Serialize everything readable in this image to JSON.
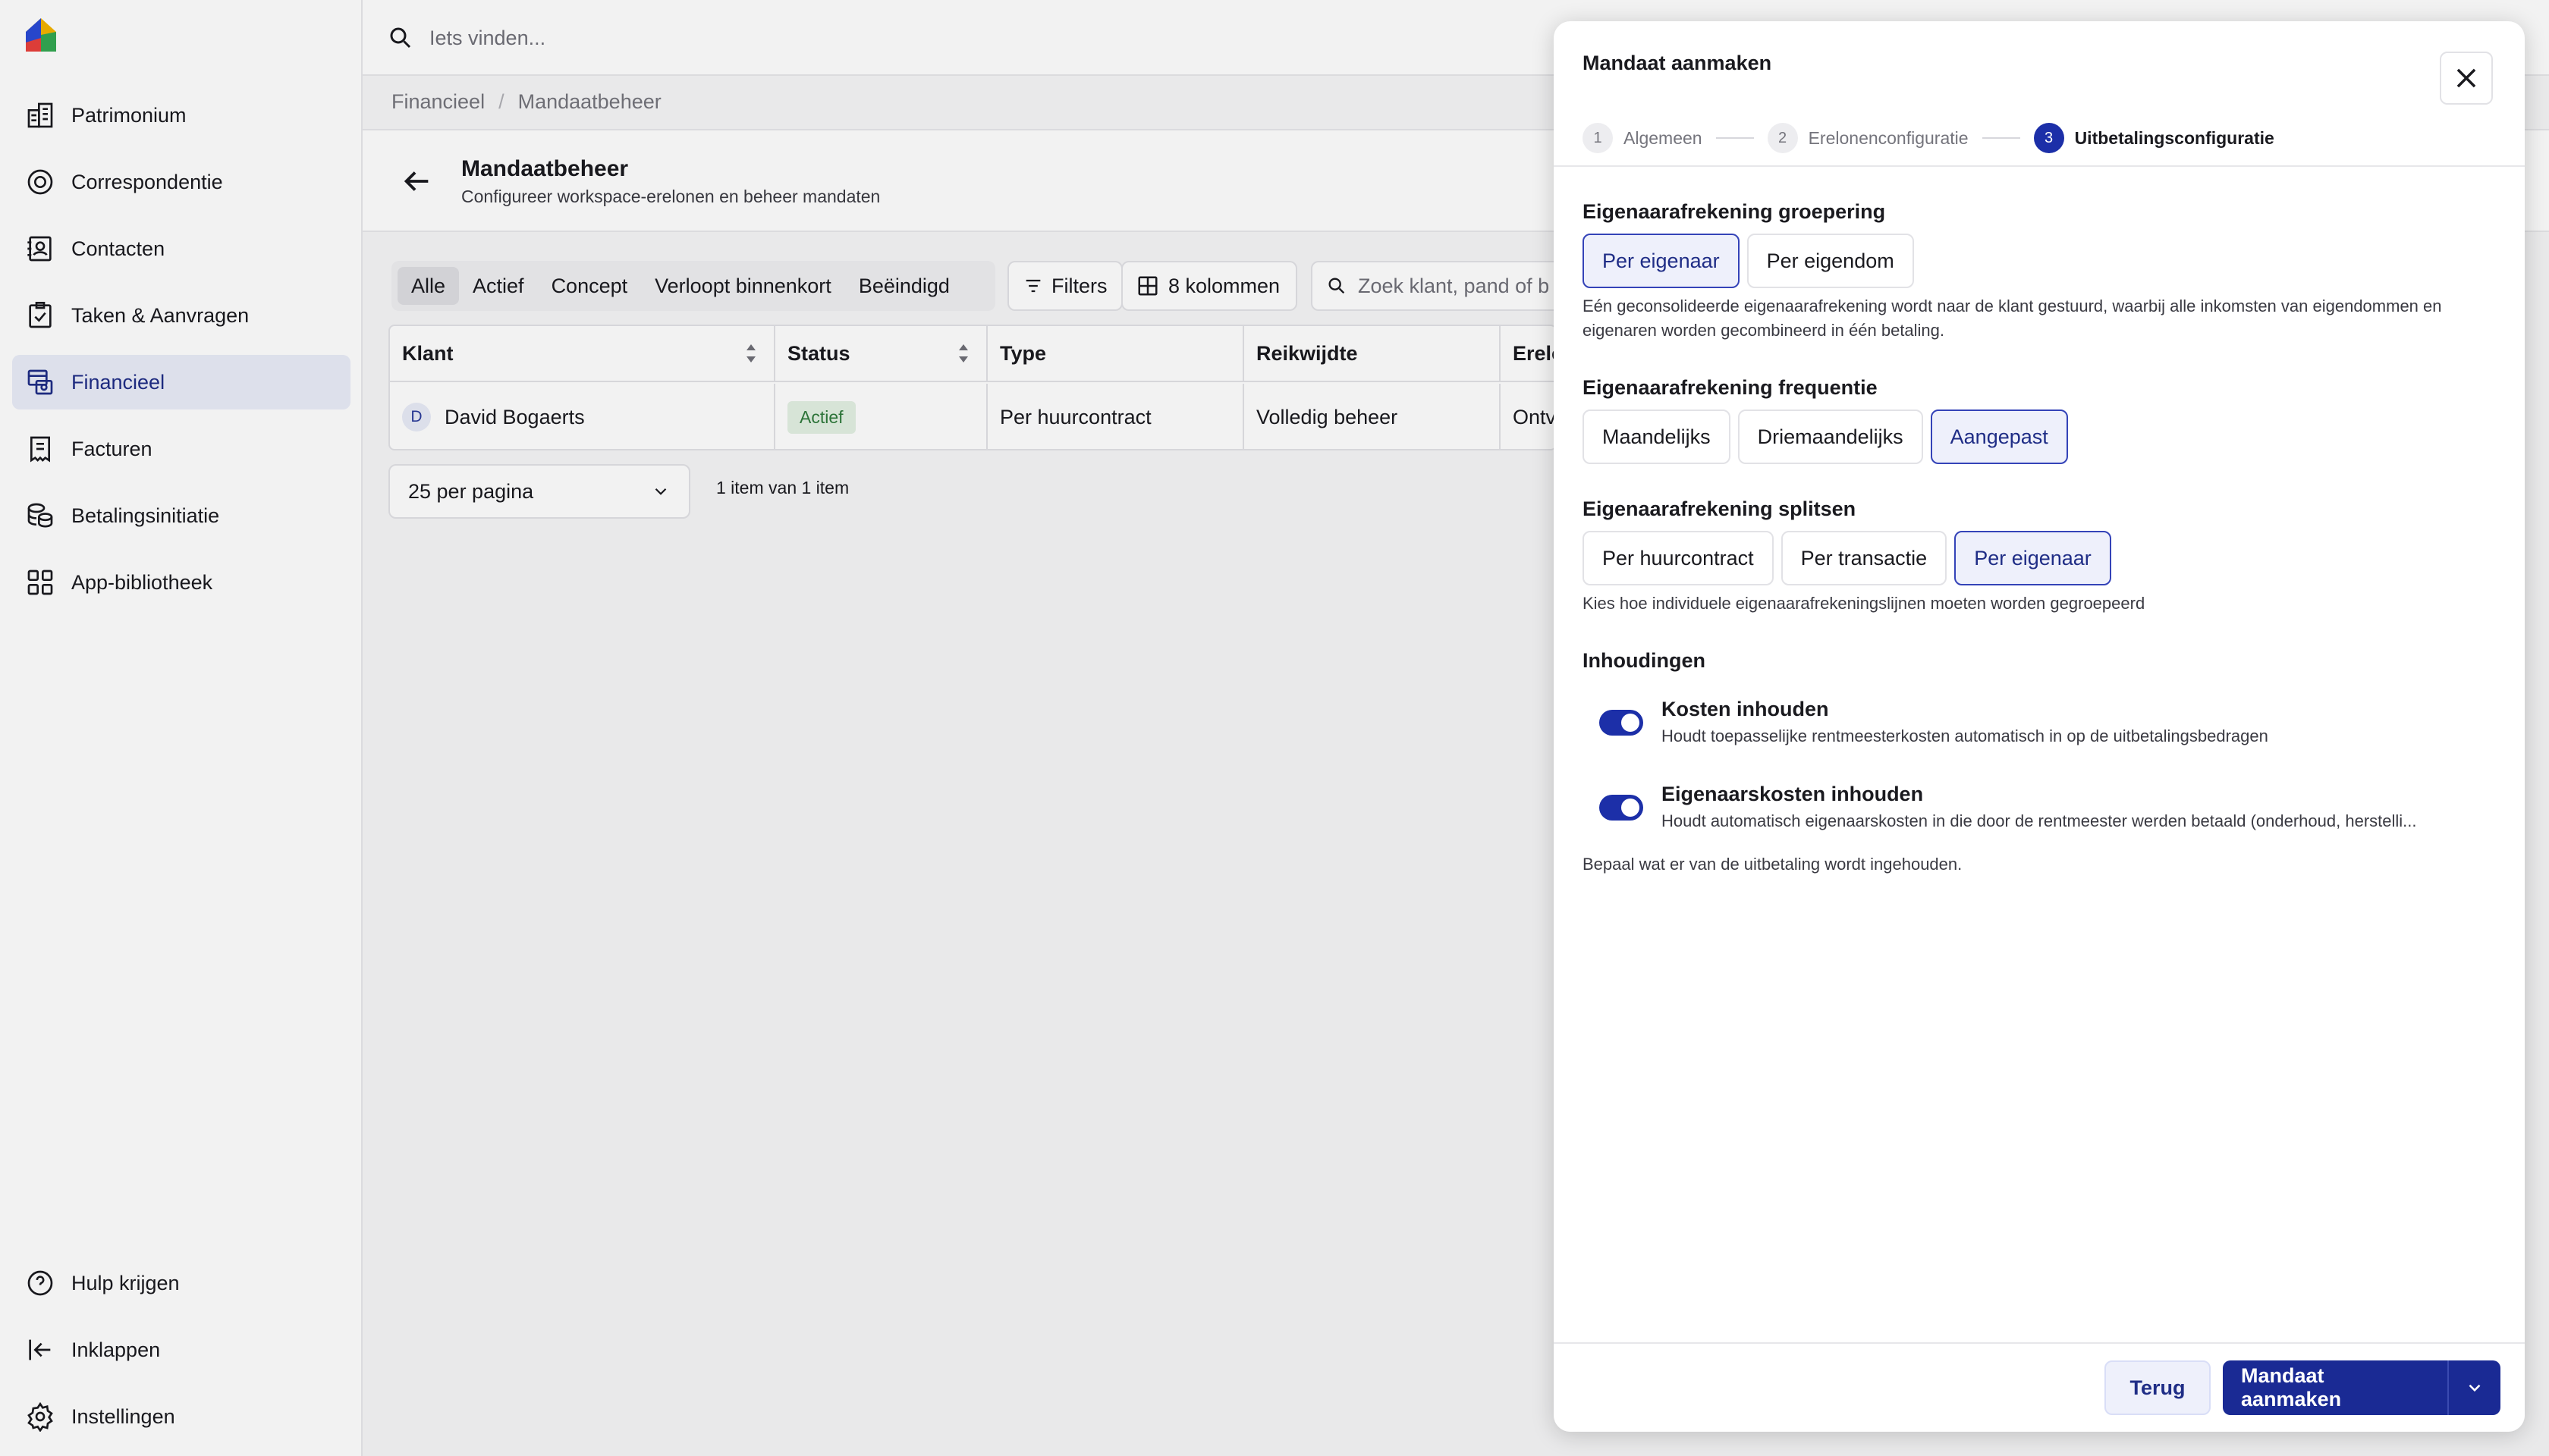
{
  "search": {
    "placeholder": "Iets vinden..."
  },
  "sidebar": {
    "items": [
      {
        "label": "Patrimonium",
        "icon": "building-icon"
      },
      {
        "label": "Correspondentie",
        "icon": "mail-circle-icon"
      },
      {
        "label": "Contacten",
        "icon": "contacts-icon"
      },
      {
        "label": "Taken & Aanvragen",
        "icon": "clipboard-check-icon"
      },
      {
        "label": "Financieel",
        "icon": "finance-icon",
        "active": true
      },
      {
        "label": "Facturen",
        "icon": "receipt-icon"
      },
      {
        "label": "Betalingsinitiatie",
        "icon": "coins-icon"
      },
      {
        "label": "App-bibliotheek",
        "icon": "grid-icon"
      }
    ],
    "bottom": [
      {
        "label": "Hulp krijgen",
        "icon": "help-icon"
      },
      {
        "label": "Inklappen",
        "icon": "collapse-icon"
      },
      {
        "label": "Instellingen",
        "icon": "gear-icon"
      }
    ]
  },
  "breadcrumb": [
    "Financieel",
    "Mandaatbeheer"
  ],
  "page": {
    "title": "Mandaatbeheer",
    "subtitle": "Configureer workspace-erelonen en beheer mandaten"
  },
  "filters": {
    "segments": [
      "Alle",
      "Actief",
      "Concept",
      "Verloopt binnenkort",
      "Beëindigd"
    ],
    "filters_label": "Filters",
    "columns_label": "8 kolommen",
    "search_placeholder": "Zoek klant, pand of b"
  },
  "table": {
    "headers": [
      "Klant",
      "Status",
      "Type",
      "Reikwijdte",
      "Erelo"
    ],
    "row": {
      "avatar": "D",
      "client": "David Bogaerts",
      "status": "Actief",
      "type": "Per huurcontract",
      "scope": "Volledig beheer",
      "fee": "Ontv"
    }
  },
  "pagination": {
    "per_page": "25 per pagina",
    "info": "1 item van 1 item"
  },
  "panel": {
    "title": "Mandaat aanmaken",
    "steps": [
      {
        "num": "1",
        "label": "Algemeen"
      },
      {
        "num": "2",
        "label": "Erelonenconfiguratie"
      },
      {
        "num": "3",
        "label": "Uitbetalingsconfiguratie",
        "active": true
      }
    ],
    "grouping": {
      "title": "Eigenaarafrekening groepering",
      "options": [
        "Per eigenaar",
        "Per eigendom"
      ],
      "selected": "Per eigenaar",
      "help": "Eén geconsolideerde eigenaarafrekening wordt naar de klant gestuurd, waarbij alle inkomsten van eigendommen en eigenaren worden gecombineerd in één betaling."
    },
    "frequency": {
      "title": "Eigenaarafrekening frequentie",
      "options": [
        "Maandelijks",
        "Driemaandelijks",
        "Aangepast"
      ],
      "selected": "Aangepast"
    },
    "split": {
      "title": "Eigenaarafrekening splitsen",
      "options": [
        "Per huurcontract",
        "Per transactie",
        "Per eigenaar"
      ],
      "selected": "Per eigenaar",
      "help": "Kies hoe individuele eigenaarafrekeningslijnen moeten worden gegroepeerd"
    },
    "withholdings": {
      "title": "Inhoudingen",
      "items": [
        {
          "title": "Kosten inhouden",
          "desc": "Houdt toepasselijke rentmeesterkosten automatisch in op de uitbetalingsbedragen",
          "on": true
        },
        {
          "title": "Eigenaarskosten inhouden",
          "desc": "Houdt automatisch eigenaarskosten in die door de rentmeester werden betaald (onderhoud, herstelli...",
          "on": true
        }
      ],
      "help": "Bepaal wat er van de uitbetaling wordt ingehouden."
    },
    "footer": {
      "back": "Terug",
      "submit": "Mandaat aanmaken"
    }
  },
  "colors": {
    "accent": "#1a2a94",
    "selected_bg": "#eef0fb",
    "active_nav_bg": "#e9ecf8"
  }
}
